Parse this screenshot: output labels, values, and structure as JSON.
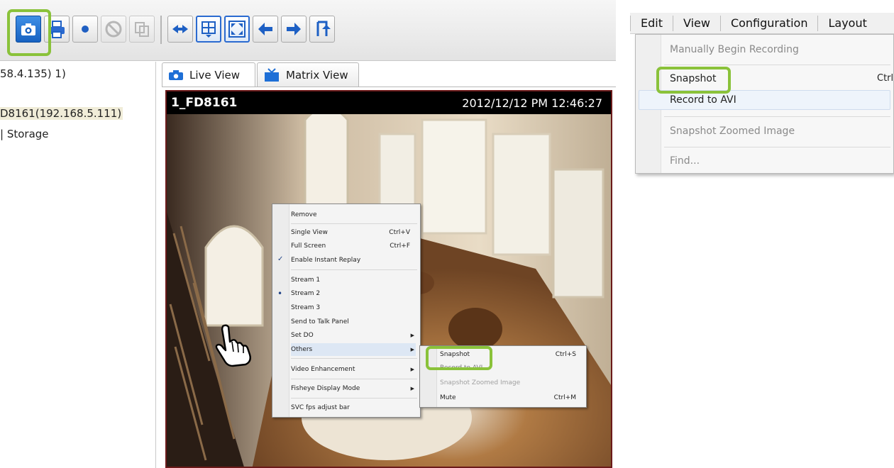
{
  "left_panel": {
    "rows": [
      "58.4.135) 1)",
      "D8161(192.168.5.111)",
      "Storage"
    ]
  },
  "tabs": [
    {
      "label": "Live View",
      "icon": "camera-icon"
    },
    {
      "label": "Matrix View",
      "icon": "monitor-icon"
    }
  ],
  "video": {
    "camera_name": "1_FD8161",
    "timestamp": "2012/12/12 PM 12:46:27"
  },
  "context_menu": {
    "remove": "Remove",
    "single_view": "Single View",
    "single_view_shortcut": "Ctrl+V",
    "full_screen": "Full Screen",
    "full_screen_shortcut": "Ctrl+F",
    "instant_replay": "Enable Instant Replay",
    "stream1": "Stream 1",
    "stream2": "Stream 2",
    "stream3": "Stream 3",
    "talk_panel": "Send to Talk Panel",
    "set_do": "Set DO",
    "others": "Others",
    "video_enhancement": "Video Enhancement",
    "fisheye": "Fisheye Display Mode",
    "svc": "SVC fps adjust bar"
  },
  "sub_menu": {
    "snapshot": "Snapshot",
    "snapshot_shortcut": "Ctrl+S",
    "record_avi": "Record to AVI",
    "snapshot_zoomed": "Snapshot Zoomed Image",
    "mute": "Mute",
    "mute_shortcut": "Ctrl+M"
  },
  "menubar": [
    "Edit",
    "View",
    "Configuration",
    "Layout"
  ],
  "edit_menu": {
    "manual_recording": "Manually Begin Recording",
    "snapshot": "Snapshot",
    "snapshot_shortcut": "Ctrl+S",
    "record_avi": "Record to AVI",
    "snapshot_zoomed": "Snapshot Zoomed Image",
    "find": "Find..."
  },
  "colors": {
    "highlight": "#8ac23a",
    "toolbar_blue": "#1762c2"
  }
}
